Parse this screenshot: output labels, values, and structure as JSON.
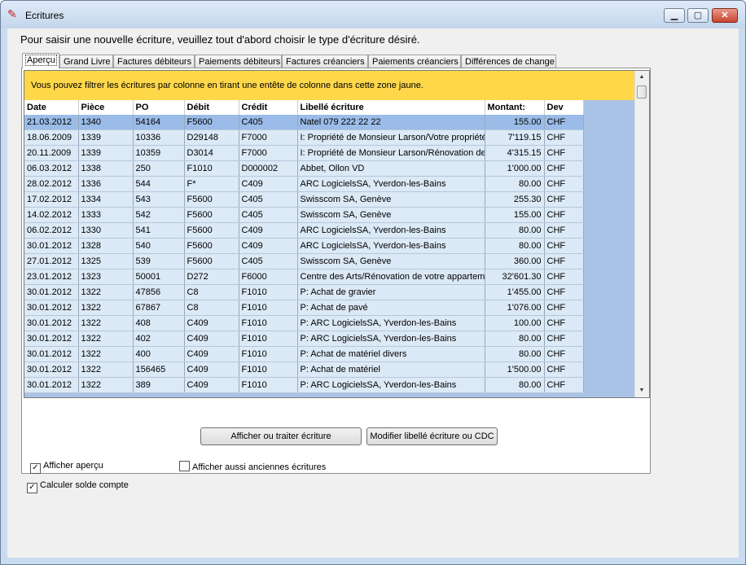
{
  "window": {
    "title": "Ecritures",
    "min_icon": "minimize-icon",
    "max_icon": "maximize-icon",
    "close_icon": "close-icon"
  },
  "instruction": "Pour saisir une nouvelle écriture, veuillez tout d'abord choisir le type d'écriture désiré.",
  "tabs": [
    "Aperçu",
    "Grand Livre",
    "Factures débiteurs",
    "Paiements débiteurs",
    "Factures créanciers",
    "Paiements créanciers",
    "Différences de change"
  ],
  "active_tab": "Aperçu",
  "group_panel_text": "Vous pouvez filtrer les écritures par colonne en tirant une entête de colonne dans cette zone jaune.",
  "columns": [
    "Date",
    "Pièce",
    "PO",
    "Débit",
    "Crédit",
    "Libellé écriture",
    "Montant:",
    "Dev"
  ],
  "rows": [
    [
      "21.03.2012",
      "1340",
      "54164",
      "F5600",
      "C405",
      "Natel 079 222 22 22",
      "155.00",
      "CHF"
    ],
    [
      "18.06.2009",
      "1339",
      "10336",
      "D29148",
      "F7000",
      "I: Propriété de Monsieur Larson/Votre propriété,",
      "7'119.15",
      "CHF"
    ],
    [
      "20.11.2009",
      "1339",
      "10359",
      "D3014",
      "F7000",
      "I: Propriété de Monsieur Larson/Rénovation de",
      "4'315.15",
      "CHF"
    ],
    [
      "06.03.2012",
      "1338",
      "250",
      "F1010",
      "D000002",
      "Abbet, Ollon VD",
      "1'000.00",
      "CHF"
    ],
    [
      "28.02.2012",
      "1336",
      "544",
      "F*",
      "C409",
      "ARC LogicielsSA, Yverdon-les-Bains",
      "80.00",
      "CHF"
    ],
    [
      "17.02.2012",
      "1334",
      "543",
      "F5600",
      "C405",
      "Swisscom SA, Genève",
      "255.30",
      "CHF"
    ],
    [
      "14.02.2012",
      "1333",
      "542",
      "F5600",
      "C405",
      "Swisscom SA, Genève",
      "155.00",
      "CHF"
    ],
    [
      "06.02.2012",
      "1330",
      "541",
      "F5600",
      "C409",
      "ARC LogicielsSA, Yverdon-les-Bains",
      "80.00",
      "CHF"
    ],
    [
      "30.01.2012",
      "1328",
      "540",
      "F5600",
      "C409",
      "ARC LogicielsSA, Yverdon-les-Bains",
      "80.00",
      "CHF"
    ],
    [
      "27.01.2012",
      "1325",
      "539",
      "F5600",
      "C405",
      "Swisscom SA, Genève",
      "360.00",
      "CHF"
    ],
    [
      "23.01.2012",
      "1323",
      "50001",
      "D272",
      "F6000",
      "Centre des Arts/Rénovation de votre apparteme",
      "32'601.30",
      "CHF"
    ],
    [
      "30.01.2012",
      "1322",
      "47856",
      "C8",
      "F1010",
      "P: Achat de gravier",
      "1'455.00",
      "CHF"
    ],
    [
      "30.01.2012",
      "1322",
      "67867",
      "C8",
      "F1010",
      "P: Achat de pavé",
      "1'076.00",
      "CHF"
    ],
    [
      "30.01.2012",
      "1322",
      "408",
      "C409",
      "F1010",
      "P: ARC LogicielsSA, Yverdon-les-Bains",
      "100.00",
      "CHF"
    ],
    [
      "30.01.2012",
      "1322",
      "402",
      "C409",
      "F1010",
      "P: ARC LogicielsSA, Yverdon-les-Bains",
      "80.00",
      "CHF"
    ],
    [
      "30.01.2012",
      "1322",
      "400",
      "C409",
      "F1010",
      "P: Achat de matériel divers",
      "80.00",
      "CHF"
    ],
    [
      "30.01.2012",
      "1322",
      "156465",
      "C409",
      "F1010",
      "P: Achat de matériel",
      "1'500.00",
      "CHF"
    ],
    [
      "30.01.2012",
      "1322",
      "389",
      "C409",
      "F1010",
      "P: ARC LogicielsSA, Yverdon-les-Bains",
      "80.00",
      "CHF"
    ]
  ],
  "selected_row": 0,
  "buttons": {
    "show": "Afficher ou traiter écriture",
    "modify": "Modifier libellé écriture ou CDC"
  },
  "checkboxes": {
    "apercu": {
      "label": "Afficher aperçu",
      "checked": true
    },
    "anciennes": {
      "label": "Afficher aussi anciennes écritures",
      "checked": false
    },
    "solde": {
      "label": "Calculer solde compte",
      "checked": true
    }
  }
}
